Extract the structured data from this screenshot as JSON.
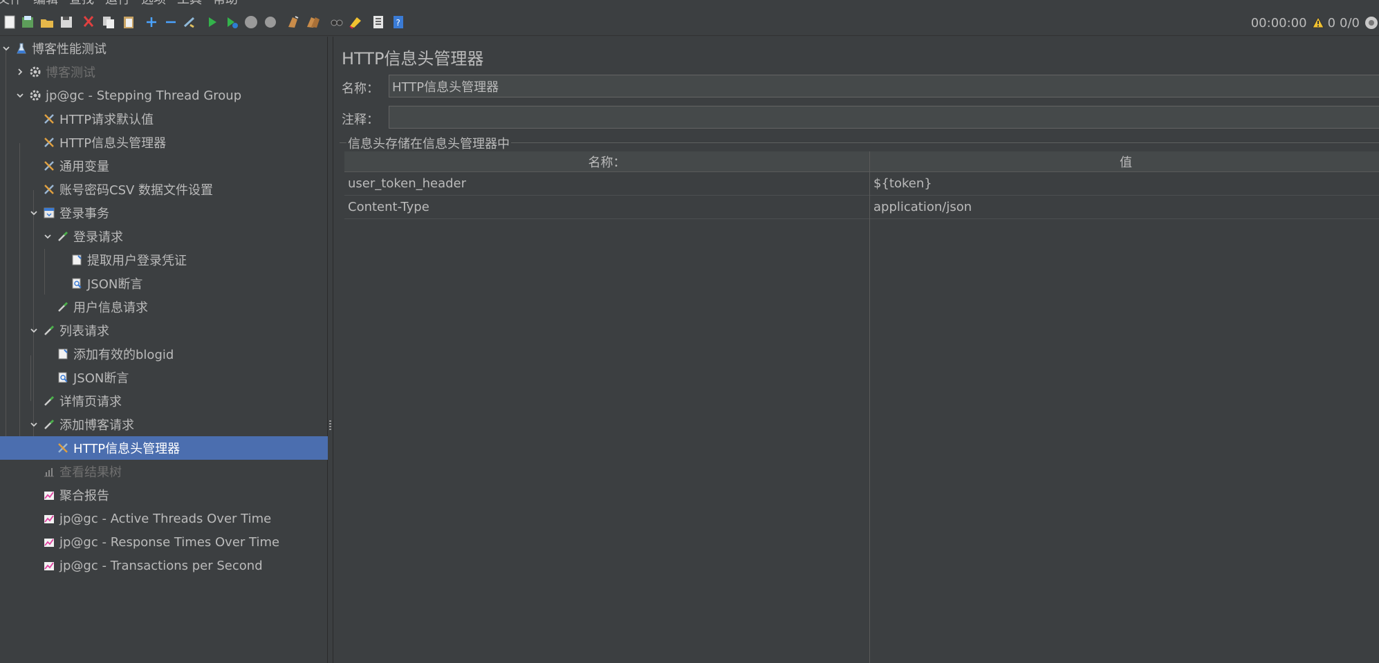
{
  "menu": [
    "文件",
    "编辑",
    "查找",
    "运行",
    "选项",
    "工具",
    "帮助"
  ],
  "toolbar": {
    "buttons": [
      "new-icon",
      "templates-icon",
      "open-icon",
      "save-icon",
      "cut-icon",
      "copy-icon",
      "paste-icon",
      "expand-icon",
      "collapse-icon",
      "toggle-icon",
      "start-icon",
      "start-no-pause-icon",
      "stop-icon",
      "shutdown-icon",
      "clear-icon",
      "clear-all-icon",
      "search-icon",
      "reset-search-icon",
      "function-helper-icon",
      "help-icon"
    ],
    "timer": "00:00:00",
    "warnings": "0",
    "threads": "0/0"
  },
  "tree": [
    {
      "label": "博客性能测试",
      "icon": "test-plan-icon",
      "disabled": false,
      "expanded": true
    },
    {
      "label": "博客测试",
      "icon": "gear-icon",
      "disabled": true,
      "expanded": false
    },
    {
      "label": "jp@gc - Stepping Thread Group",
      "icon": "gear-icon",
      "disabled": false,
      "expanded": true
    },
    {
      "label": "HTTP请求默认值",
      "icon": "config-element-icon",
      "disabled": false
    },
    {
      "label": "HTTP信息头管理器",
      "icon": "config-element-icon",
      "disabled": false
    },
    {
      "label": "通用变量",
      "icon": "config-element-icon",
      "disabled": false
    },
    {
      "label": "账号密码CSV 数据文件设置",
      "icon": "config-element-icon",
      "disabled": false
    },
    {
      "label": "登录事务",
      "icon": "transaction-icon",
      "disabled": false,
      "expanded": true
    },
    {
      "label": "登录请求",
      "icon": "sampler-icon",
      "disabled": false,
      "expanded": true
    },
    {
      "label": "提取用户登录凭证",
      "icon": "post-processor-icon",
      "disabled": false
    },
    {
      "label": "JSON断言",
      "icon": "assertion-icon",
      "disabled": false
    },
    {
      "label": "用户信息请求",
      "icon": "sampler-icon",
      "disabled": false
    },
    {
      "label": "列表请求",
      "icon": "sampler-icon",
      "disabled": false,
      "expanded": true
    },
    {
      "label": "添加有效的blogid",
      "icon": "post-processor-icon",
      "disabled": false
    },
    {
      "label": "JSON断言",
      "icon": "assertion-icon",
      "disabled": false
    },
    {
      "label": "详情页请求",
      "icon": "sampler-icon",
      "disabled": false
    },
    {
      "label": "添加博客请求",
      "icon": "sampler-icon",
      "disabled": false,
      "expanded": true
    },
    {
      "label": "HTTP信息头管理器",
      "icon": "config-element-icon",
      "disabled": false,
      "selected": true
    },
    {
      "label": "查看结果树",
      "icon": "listener-icon",
      "disabled": true
    },
    {
      "label": "聚合报告",
      "icon": "graph-icon",
      "disabled": false
    },
    {
      "label": "jp@gc - Active Threads Over Time",
      "icon": "graph-icon",
      "disabled": false
    },
    {
      "label": "jp@gc - Response Times Over Time",
      "icon": "graph-icon",
      "disabled": false
    },
    {
      "label": "jp@gc - Transactions per Second",
      "icon": "graph-icon",
      "disabled": false
    }
  ],
  "panel": {
    "title": "HTTP信息头管理器",
    "name_label": "名称：",
    "name_value": "HTTP信息头管理器",
    "comment_label": "注释：",
    "comment_value": "",
    "group_label": "信息头存储在信息头管理器中",
    "table": {
      "headers": [
        "名称：",
        "值"
      ],
      "rows": [
        [
          "user_token_header",
          "${token}"
        ],
        [
          "Content-Type",
          "application/json"
        ]
      ]
    }
  },
  "colors": {
    "background": "#3c3f41",
    "selection": "#4b6eaf",
    "text": "#bbbbbb",
    "disabled_text": "#6f6f6f"
  }
}
